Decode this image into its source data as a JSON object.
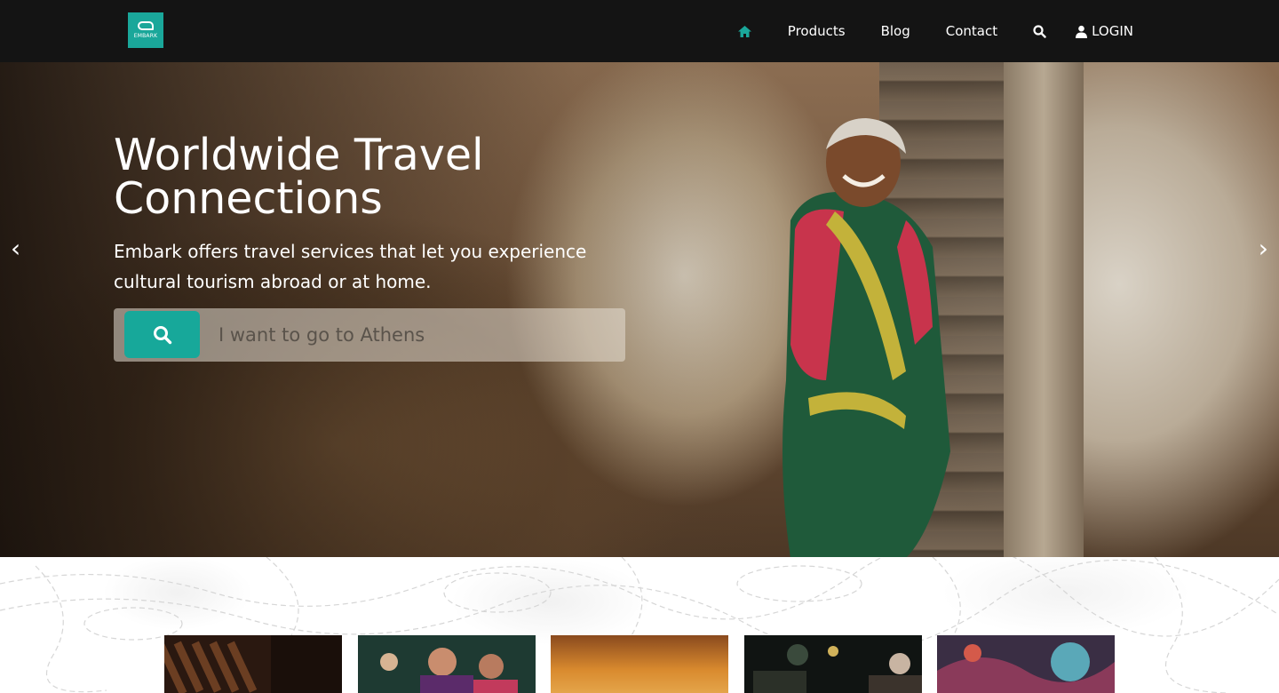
{
  "header": {
    "logo_text": "EMBARK",
    "nav": [
      {
        "label": "Products"
      },
      {
        "label": "Blog"
      },
      {
        "label": "Contact"
      }
    ],
    "login_label": "LOGIN",
    "accent_color": "#1aa79a"
  },
  "hero": {
    "title": "Worldwide Travel Connections",
    "subtitle": "Embark offers travel services that let you experience cultural tourism abroad or at home.",
    "search": {
      "value": "I want to go to Athens",
      "button_icon": "search-icon"
    },
    "prev_arrow": "‹",
    "next_arrow": "›"
  },
  "cards": [
    {
      "icon": "library-photo"
    },
    {
      "icon": "festival-photo"
    },
    {
      "icon": "sunset-photo"
    },
    {
      "icon": "market-photo"
    },
    {
      "icon": "street-art-photo"
    }
  ]
}
